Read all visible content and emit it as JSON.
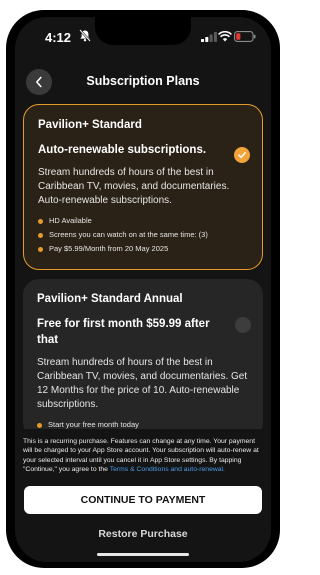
{
  "status_bar": {
    "time": "4:12",
    "icons": [
      "bell-off-icon",
      "signal-icon",
      "wifi-icon",
      "battery-icon"
    ],
    "battery_color": "#e53935"
  },
  "header": {
    "title": "Subscription Plans",
    "back_icon": "chevron-left-icon"
  },
  "plans": [
    {
      "name": "Pavilion+ Standard",
      "headline": "Auto-renewable subscriptions.",
      "description": "Stream hundreds of hours of the best in Caribbean TV, movies, and documentaries. Auto-renewable subscriptions.",
      "features": [
        "HD Available",
        "Screens you can watch on at the same time: (3)",
        "Pay $5.99/Month from 20 May 2025"
      ],
      "selected": true
    },
    {
      "name": "Pavilion+ Standard Annual",
      "headline": "Free for first month $59.99 after that",
      "description": "Stream hundreds of hours of the best in Caribbean TV, movies, and documentaries. Get 12 Months for the price of 10. Auto-renewable subscriptions.",
      "features": [
        "Start your free month today"
      ],
      "selected": false
    }
  ],
  "footer": {
    "disclaimer": "This is a recurring purchase. Features can change at any time. Your payment will be charged to your App Store account. Your subscription will auto-renew at your selected interval until you cancel it in App Store settings. By tapping \"Continue,\" you agree to the ",
    "terms_link": "Terms & Conditions and auto-renewal.",
    "continue_label": "CONTINUE TO PAYMENT",
    "restore_label": "Restore Purchase"
  },
  "colors": {
    "accent": "#f2a33a",
    "selected_border": "#e59b2a",
    "link": "#4a9de8",
    "background": "#141414"
  }
}
